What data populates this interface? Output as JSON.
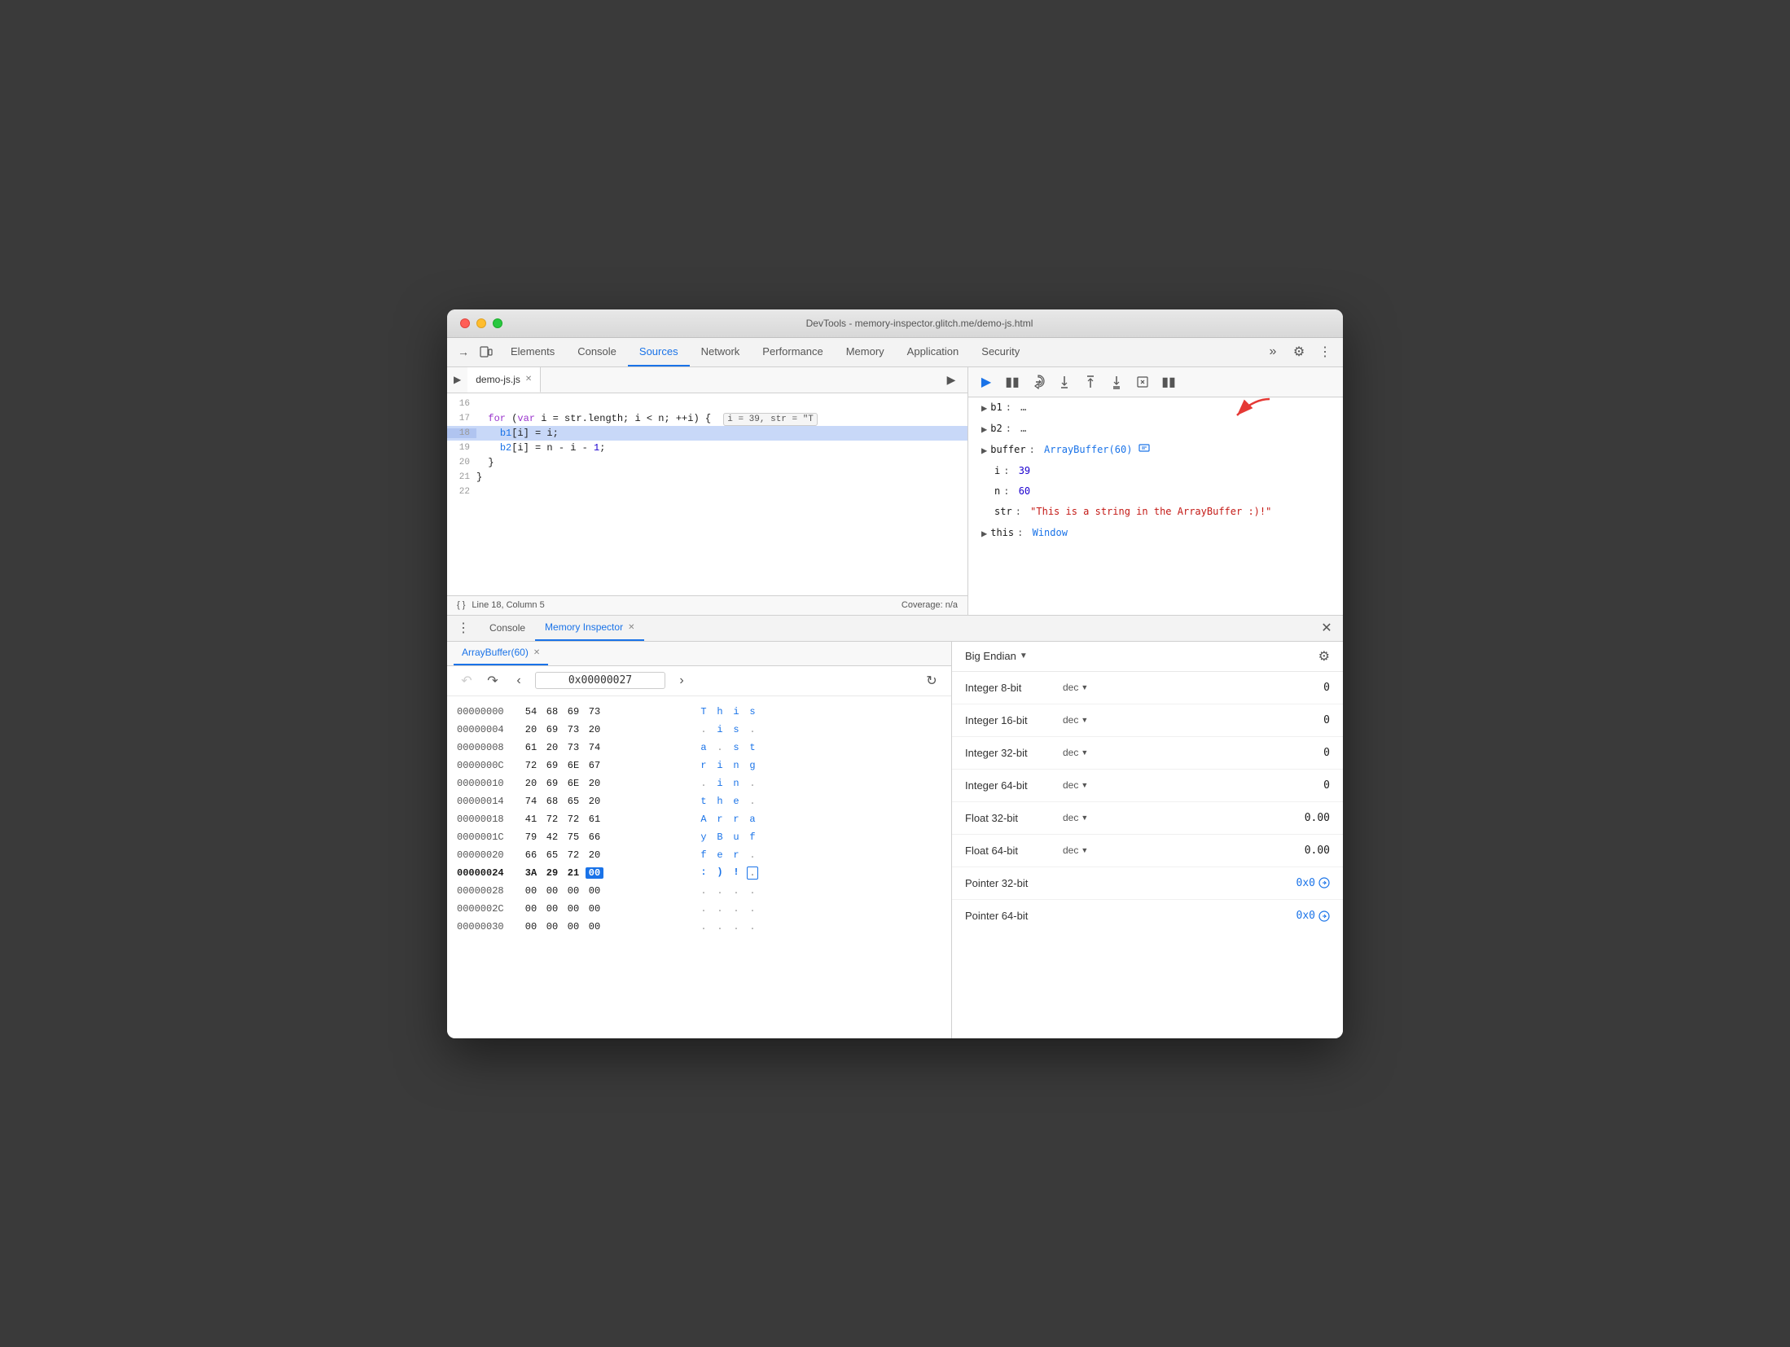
{
  "window": {
    "title": "DevTools - memory-inspector.glitch.me/demo-js.html",
    "traffic_lights": [
      "close",
      "minimize",
      "maximize"
    ]
  },
  "tabs": {
    "items": [
      {
        "label": "Elements",
        "active": false
      },
      {
        "label": "Console",
        "active": false
      },
      {
        "label": "Sources",
        "active": true
      },
      {
        "label": "Network",
        "active": false
      },
      {
        "label": "Performance",
        "active": false
      },
      {
        "label": "Memory",
        "active": false
      },
      {
        "label": "Application",
        "active": false
      },
      {
        "label": "Security",
        "active": false
      }
    ]
  },
  "editor": {
    "filename": "demo-js.js",
    "lines": [
      {
        "num": "16",
        "content": ""
      },
      {
        "num": "17",
        "content": "  for (var i = str.length; i < n; ++i) {  i = 39, str = \"T"
      },
      {
        "num": "18",
        "content": "    b1[i] = i;",
        "highlighted": true
      },
      {
        "num": "19",
        "content": "    b2[i] = n - i - 1;"
      },
      {
        "num": "20",
        "content": "  }"
      },
      {
        "num": "21",
        "content": "}"
      },
      {
        "num": "22",
        "content": ""
      }
    ],
    "status": {
      "line": "Line 18, Column 5",
      "coverage": "Coverage: n/a"
    }
  },
  "bottom_panel": {
    "tabs": [
      {
        "label": "Console",
        "active": false
      },
      {
        "label": "Memory Inspector",
        "active": true,
        "closable": true
      }
    ],
    "buffer_tab": "ArrayBuffer(60)",
    "nav": {
      "address": "0x00000027"
    },
    "hex_rows": [
      {
        "addr": "00000000",
        "bytes": [
          "54",
          "68",
          "69",
          "73"
        ],
        "chars": [
          "T",
          "h",
          "i",
          "s"
        ]
      },
      {
        "addr": "00000004",
        "bytes": [
          "20",
          "69",
          "73",
          "20"
        ],
        "chars": [
          " ",
          "i",
          "s",
          " "
        ]
      },
      {
        "addr": "00000008",
        "bytes": [
          "61",
          "20",
          "73",
          "74"
        ],
        "chars": [
          "a",
          " ",
          "s",
          "t"
        ]
      },
      {
        "addr": "0000000C",
        "bytes": [
          "72",
          "69",
          "6E",
          "67"
        ],
        "chars": [
          "r",
          "i",
          "n",
          "g"
        ]
      },
      {
        "addr": "00000010",
        "bytes": [
          "20",
          "69",
          "6E",
          "20"
        ],
        "chars": [
          " ",
          "i",
          "n",
          " "
        ]
      },
      {
        "addr": "00000014",
        "bytes": [
          "74",
          "68",
          "65",
          "20"
        ],
        "chars": [
          "t",
          "h",
          "e",
          " "
        ]
      },
      {
        "addr": "00000018",
        "bytes": [
          "41",
          "72",
          "72",
          "61"
        ],
        "chars": [
          "A",
          "r",
          "r",
          "a"
        ]
      },
      {
        "addr": "0000001C",
        "bytes": [
          "79",
          "42",
          "75",
          "66"
        ],
        "chars": [
          "y",
          "B",
          "u",
          "f"
        ]
      },
      {
        "addr": "00000020",
        "bytes": [
          "66",
          "65",
          "72",
          "20"
        ],
        "chars": [
          "f",
          "e",
          "r",
          " "
        ]
      },
      {
        "addr": "00000024",
        "bytes": [
          "3A",
          "29",
          "21",
          "00"
        ],
        "chars": [
          ":",
          ")",
          "!",
          "."
        ],
        "current": true,
        "selected_byte": 3
      },
      {
        "addr": "00000028",
        "bytes": [
          "00",
          "00",
          "00",
          "00"
        ],
        "chars": [
          ".",
          ".",
          ".",
          "."
        ]
      },
      {
        "addr": "0000002C",
        "bytes": [
          "00",
          "00",
          "00",
          "00"
        ],
        "chars": [
          ".",
          ".",
          ".",
          "."
        ]
      },
      {
        "addr": "00000030",
        "bytes": [
          "00",
          "00",
          "00",
          "00"
        ],
        "chars": [
          ".",
          ".",
          ".",
          "."
        ]
      }
    ],
    "inspector": {
      "endian": "Big Endian",
      "rows": [
        {
          "label": "Integer 8-bit",
          "format": "dec",
          "value": "0",
          "link": false
        },
        {
          "label": "Integer 16-bit",
          "format": "dec",
          "value": "0",
          "link": false
        },
        {
          "label": "Integer 32-bit",
          "format": "dec",
          "value": "0",
          "link": false
        },
        {
          "label": "Integer 64-bit",
          "format": "dec",
          "value": "0",
          "link": false
        },
        {
          "label": "Float 32-bit",
          "format": "dec",
          "value": "0.00",
          "link": false
        },
        {
          "label": "Float 64-bit",
          "format": "dec",
          "value": "0.00",
          "link": false
        },
        {
          "label": "Pointer 32-bit",
          "format": "",
          "value": "0x0",
          "link": true
        },
        {
          "label": "Pointer 64-bit",
          "format": "",
          "value": "0x0",
          "link": true
        }
      ]
    }
  },
  "scope": {
    "items": [
      {
        "key": "b1",
        "val": "…",
        "arrow": true,
        "indent": 0
      },
      {
        "key": "b2",
        "val": "…",
        "arrow": true,
        "indent": 0
      },
      {
        "key": "buffer",
        "val": "ArrayBuffer(60)",
        "arrow": true,
        "has_icon": true,
        "indent": 0
      },
      {
        "key": "i",
        "val": "39",
        "arrow": false,
        "indent": 1,
        "type": "num"
      },
      {
        "key": "n",
        "val": "60",
        "arrow": false,
        "indent": 1,
        "type": "num"
      },
      {
        "key": "str",
        "val": "\"This is a string in the ArrayBuffer :)!\"",
        "arrow": false,
        "indent": 1,
        "type": "str"
      },
      {
        "key": "this",
        "val": "Window",
        "arrow": true,
        "indent": 0
      }
    ]
  }
}
